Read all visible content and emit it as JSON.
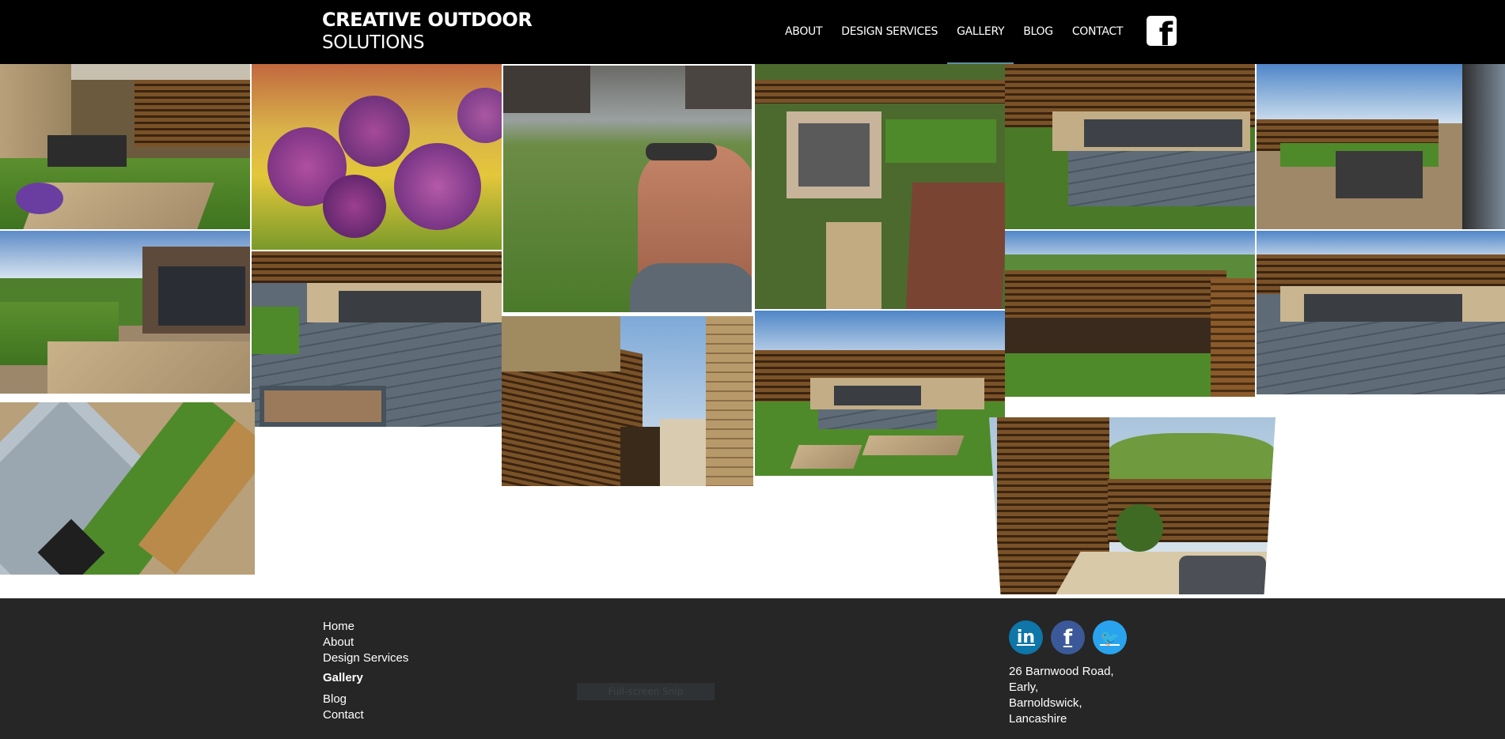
{
  "header": {
    "logo_line1": "CREATIVE OUTDOOR",
    "logo_line2": "SOLUTIONS",
    "nav": [
      {
        "label": "ABOUT",
        "active": false
      },
      {
        "label": "DESIGN SERVICES",
        "active": false
      },
      {
        "label": "GALLERY",
        "active": true
      },
      {
        "label": "BLOG",
        "active": false
      },
      {
        "label": "CONTACT",
        "active": false
      }
    ],
    "facebook_icon": "facebook-square-icon",
    "active_underline_color": "#5f8fa0"
  },
  "gallery": {
    "photos": [
      {
        "subject": "patio with dining set and purple flowers"
      },
      {
        "subject": "purple allium flowers"
      },
      {
        "subject": "selfie in wildflower meadow"
      },
      {
        "subject": "aerial view of garden with seating area"
      },
      {
        "subject": "sunken seating area with grey deck"
      },
      {
        "subject": "patio dining area beside house"
      },
      {
        "subject": "lawn with patio and bungalow"
      },
      {
        "subject": "grey composite deck with corner sofa"
      },
      {
        "subject": "slatted fence along side passage"
      },
      {
        "subject": "garden seating area with stepping stones"
      },
      {
        "subject": "slatted fence and planted border"
      },
      {
        "subject": "corner sofa on grey deck"
      },
      {
        "subject": "close-up of deck edge and lawn"
      },
      {
        "subject": "slatted fence with raised bed"
      }
    ]
  },
  "footer": {
    "links": [
      {
        "label": "Home",
        "current": false
      },
      {
        "label": "About",
        "current": false
      },
      {
        "label": "Design Services",
        "current": false
      },
      {
        "label": "Gallery",
        "current": true
      },
      {
        "label": "Blog",
        "current": false
      },
      {
        "label": "Contact",
        "current": false
      }
    ],
    "overlay_label": "Full-screen Snip",
    "social": [
      {
        "name": "linkedin-icon",
        "glyph": "in",
        "color": "#0e76a8"
      },
      {
        "name": "facebook-icon",
        "glyph": "f",
        "color": "#3b5998"
      },
      {
        "name": "twitter-icon",
        "glyph": "🐦",
        "color": "#2aa3ef"
      }
    ],
    "address": [
      "26 Barnwood Road,",
      "Early,",
      "Barnoldswick,",
      "Lancashire"
    ]
  }
}
